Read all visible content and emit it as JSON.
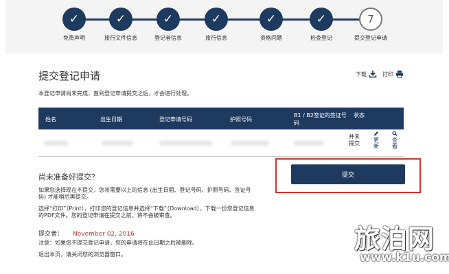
{
  "stepper": {
    "check": "✓",
    "steps": [
      {
        "label": "免责声明",
        "done": true
      },
      {
        "label": "旅行文件信息",
        "done": true
      },
      {
        "label": "登记者信息",
        "done": true
      },
      {
        "label": "旅行信息",
        "done": true
      },
      {
        "label": "资格问题",
        "done": true
      },
      {
        "label": "检查登记",
        "done": true
      },
      {
        "label": "提交登记申请",
        "done": false,
        "number": "7"
      }
    ]
  },
  "header": {
    "title": "提交登记申请",
    "download_label": "下载",
    "print_label": "打印"
  },
  "notice": "本登记申请尚未完成，直到登记申请提交之后，才会进行处理。",
  "table": {
    "headers": [
      "姓名",
      "出生日期",
      "登记申请号码",
      "护照号码",
      "B1 / B2签证的签证号码",
      "状态"
    ],
    "row": {
      "status": "并未提交",
      "edit_label": "更新",
      "view_label": "查看"
    }
  },
  "not_ready": {
    "title": "尚未准备好提交？",
    "para1": "如果您选择现在不提交，您将需要以上的信息 (出生日期、登记号码、护照号码、签证号码) 才能稍后再提交。",
    "para2": "选择“打印”（Print），打印您的登记信息并选择“下载”（Download），下载一份您登记信息的PDF文件。您的登记申请在提交之前，将不会被审查。",
    "submitted_label": "提交者：",
    "submitted_date": "November 02, 2016",
    "note": "注意：如果您不提交登记申请，您的申请将在此日期之后被删除。",
    "exit": "退出本页，请关闭您的浏览器窗口。"
  },
  "submit_label": "提交",
  "watermark": {
    "text": "旅泊网",
    "url": "www.k1u.com"
  },
  "colors": {
    "primary": "#1e3a5f",
    "highlight": "#d9302a",
    "date": "#c0392b"
  }
}
